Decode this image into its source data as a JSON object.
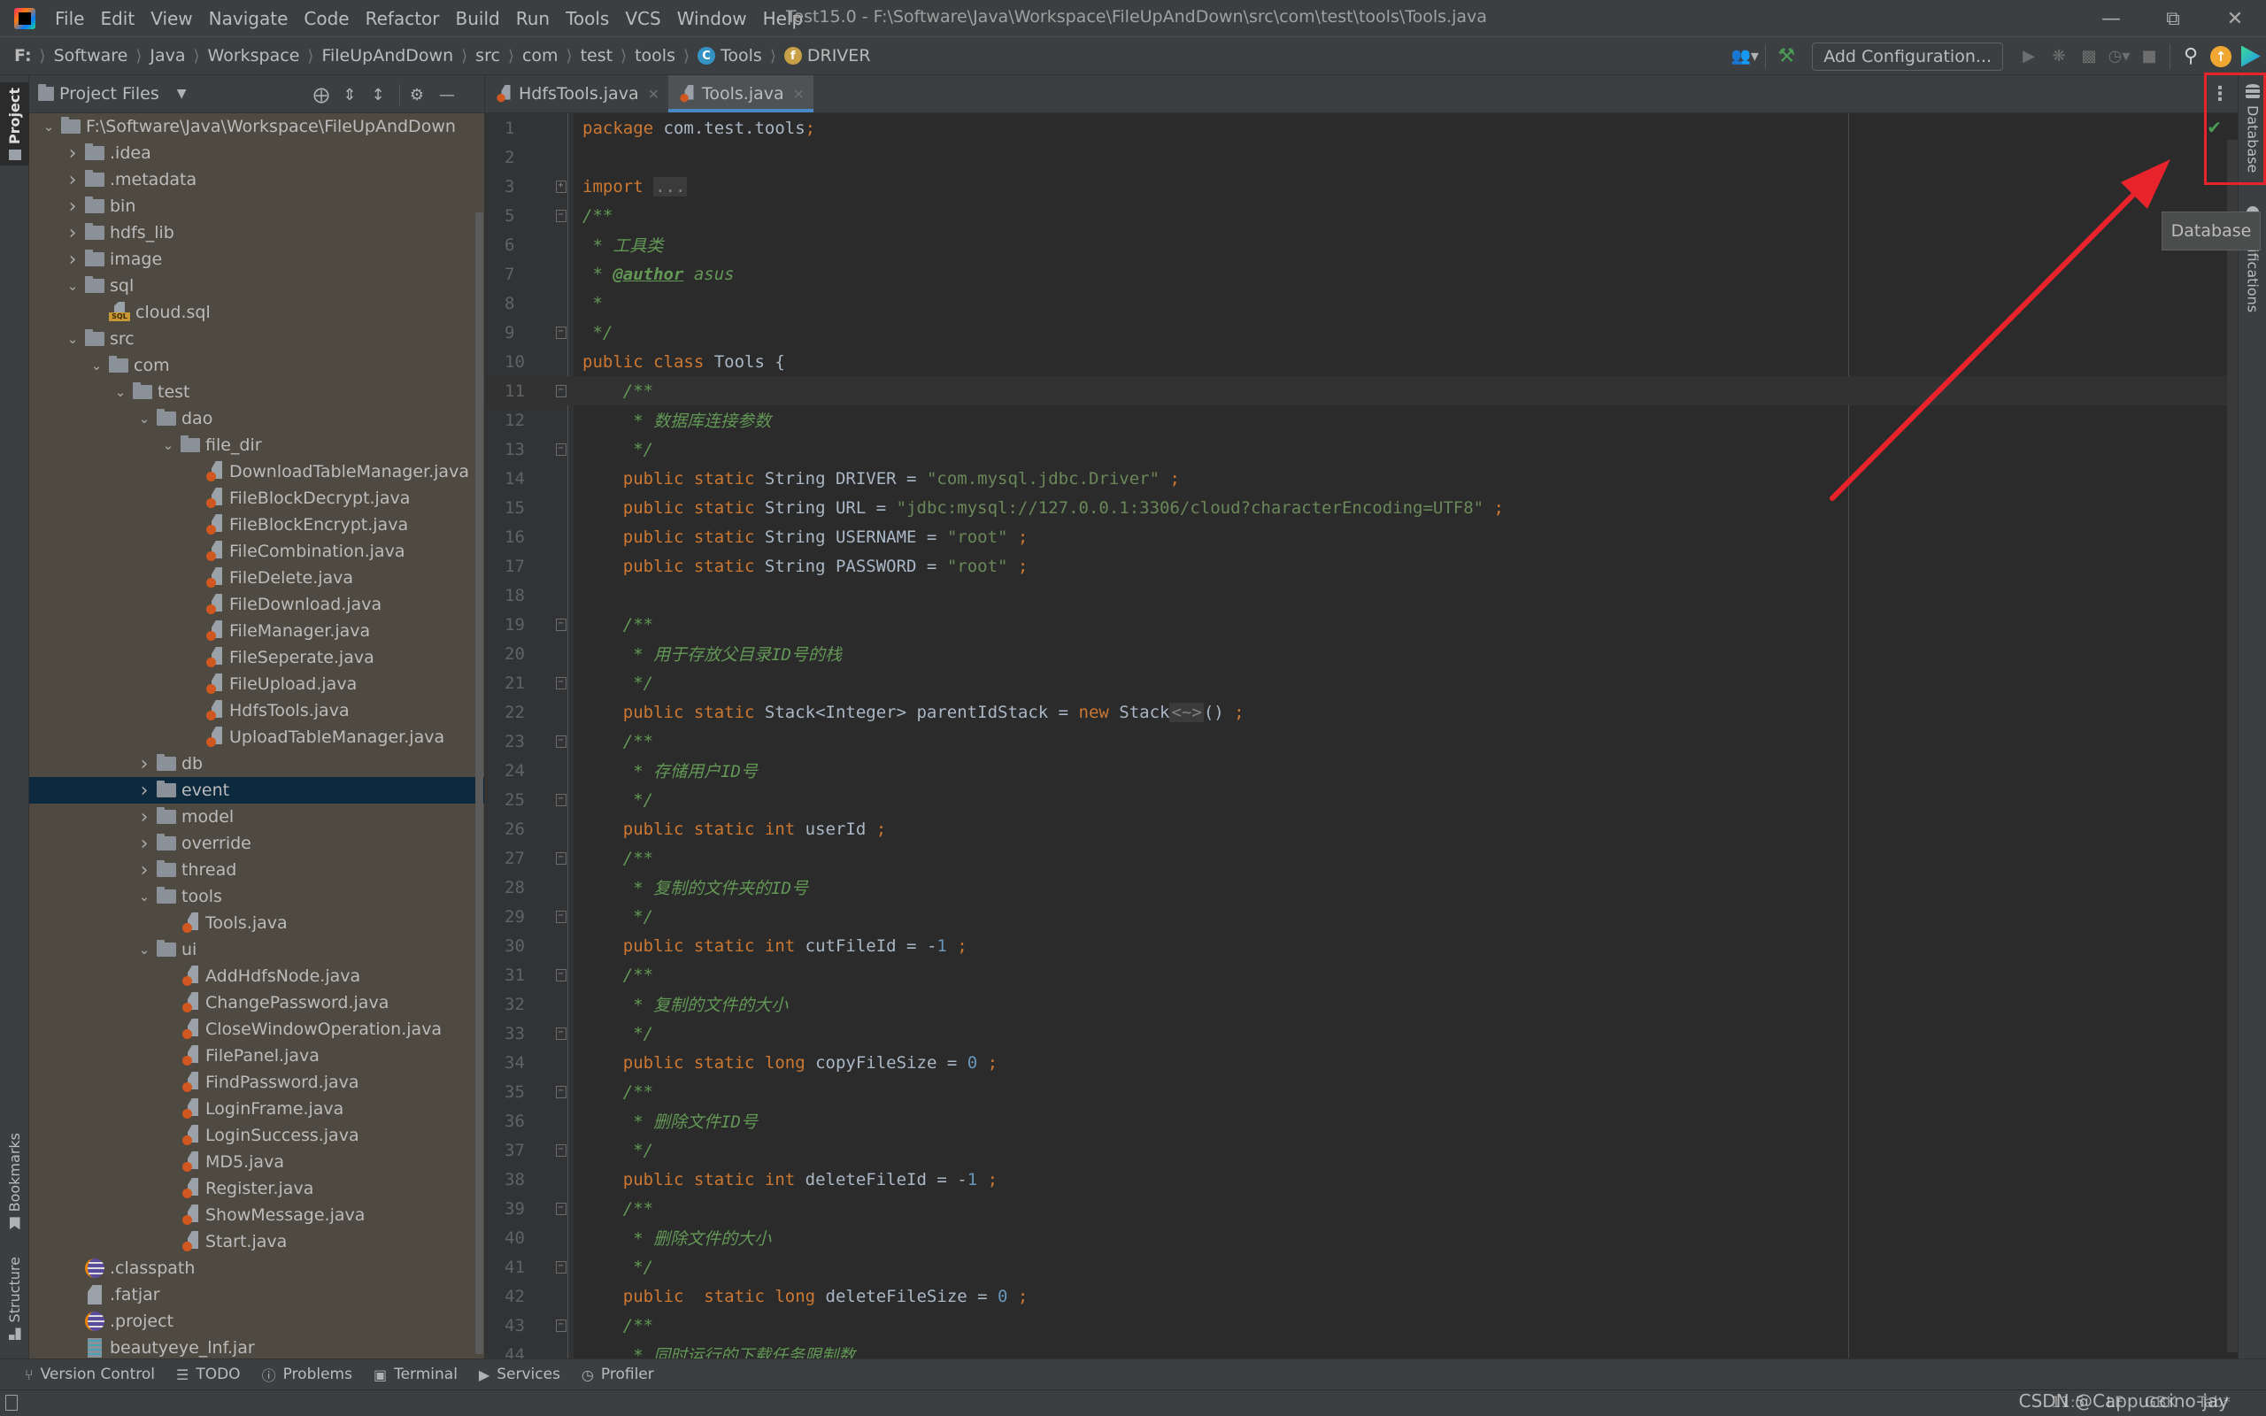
{
  "app": {
    "window_title": "Test15.0 - F:\\Software\\Java\\Workspace\\FileUpAndDown\\src\\com\\test\\tools\\Tools.java",
    "menu": [
      "File",
      "Edit",
      "View",
      "Navigate",
      "Code",
      "Refactor",
      "Build",
      "Run",
      "Tools",
      "VCS",
      "Window",
      "Help"
    ]
  },
  "breadcrumb": [
    "F:",
    "Software",
    "Java",
    "Workspace",
    "FileUpAndDown",
    "src",
    "com",
    "test",
    "tools",
    "Tools",
    "DRIVER"
  ],
  "breadcrumb_icons": {
    "class": "C",
    "field": "f"
  },
  "toolbar": {
    "add_configuration": "Add Configuration..."
  },
  "left_strip": {
    "project": "Project",
    "bookmarks": "Bookmarks",
    "structure": "Structure"
  },
  "right_strip": {
    "database": "Database",
    "notifications": "Notifications"
  },
  "project_panel": {
    "title": "Project Files",
    "tree": [
      {
        "label": "F:\\Software\\Java\\Workspace\\FileUpAndDown",
        "depth": 0,
        "type": "folder",
        "expanded": true
      },
      {
        "label": ".idea",
        "depth": 1,
        "type": "folder",
        "expanded": false
      },
      {
        "label": ".metadata",
        "depth": 1,
        "type": "folder",
        "expanded": false
      },
      {
        "label": "bin",
        "depth": 1,
        "type": "folder",
        "expanded": false
      },
      {
        "label": "hdfs_lib",
        "depth": 1,
        "type": "folder",
        "expanded": false
      },
      {
        "label": "image",
        "depth": 1,
        "type": "folder",
        "expanded": false
      },
      {
        "label": "sql",
        "depth": 1,
        "type": "folder",
        "expanded": true
      },
      {
        "label": "cloud.sql",
        "depth": 2,
        "type": "sql"
      },
      {
        "label": "src",
        "depth": 1,
        "type": "folder",
        "expanded": true
      },
      {
        "label": "com",
        "depth": 2,
        "type": "folder",
        "expanded": true
      },
      {
        "label": "test",
        "depth": 3,
        "type": "folder",
        "expanded": true
      },
      {
        "label": "dao",
        "depth": 4,
        "type": "folder",
        "expanded": true
      },
      {
        "label": "file_dir",
        "depth": 5,
        "type": "folder",
        "expanded": true
      },
      {
        "label": "DownloadTableManager.java",
        "depth": 6,
        "type": "java"
      },
      {
        "label": "FileBlockDecrypt.java",
        "depth": 6,
        "type": "java"
      },
      {
        "label": "FileBlockEncrypt.java",
        "depth": 6,
        "type": "java"
      },
      {
        "label": "FileCombination.java",
        "depth": 6,
        "type": "java"
      },
      {
        "label": "FileDelete.java",
        "depth": 6,
        "type": "java"
      },
      {
        "label": "FileDownload.java",
        "depth": 6,
        "type": "java"
      },
      {
        "label": "FileManager.java",
        "depth": 6,
        "type": "java"
      },
      {
        "label": "FileSeperate.java",
        "depth": 6,
        "type": "java"
      },
      {
        "label": "FileUpload.java",
        "depth": 6,
        "type": "java"
      },
      {
        "label": "HdfsTools.java",
        "depth": 6,
        "type": "java"
      },
      {
        "label": "UploadTableManager.java",
        "depth": 6,
        "type": "java"
      },
      {
        "label": "db",
        "depth": 4,
        "type": "folder",
        "expanded": false
      },
      {
        "label": "event",
        "depth": 4,
        "type": "folder",
        "expanded": false,
        "selected": true
      },
      {
        "label": "model",
        "depth": 4,
        "type": "folder",
        "expanded": false
      },
      {
        "label": "override",
        "depth": 4,
        "type": "folder",
        "expanded": false
      },
      {
        "label": "thread",
        "depth": 4,
        "type": "folder",
        "expanded": false
      },
      {
        "label": "tools",
        "depth": 4,
        "type": "folder",
        "expanded": true
      },
      {
        "label": "Tools.java",
        "depth": 5,
        "type": "java"
      },
      {
        "label": "ui",
        "depth": 4,
        "type": "folder",
        "expanded": true
      },
      {
        "label": "AddHdfsNode.java",
        "depth": 5,
        "type": "java"
      },
      {
        "label": "ChangePassword.java",
        "depth": 5,
        "type": "java"
      },
      {
        "label": "CloseWindowOperation.java",
        "depth": 5,
        "type": "java"
      },
      {
        "label": "FilePanel.java",
        "depth": 5,
        "type": "java"
      },
      {
        "label": "FindPassword.java",
        "depth": 5,
        "type": "java"
      },
      {
        "label": "LoginFrame.java",
        "depth": 5,
        "type": "java"
      },
      {
        "label": "LoginSuccess.java",
        "depth": 5,
        "type": "java"
      },
      {
        "label": "MD5.java",
        "depth": 5,
        "type": "java"
      },
      {
        "label": "Register.java",
        "depth": 5,
        "type": "java"
      },
      {
        "label": "ShowMessage.java",
        "depth": 5,
        "type": "java"
      },
      {
        "label": "Start.java",
        "depth": 5,
        "type": "java"
      },
      {
        "label": ".classpath",
        "depth": 1,
        "type": "eclipse"
      },
      {
        "label": ".fatjar",
        "depth": 1,
        "type": "text"
      },
      {
        "label": ".project",
        "depth": 1,
        "type": "eclipse"
      },
      {
        "label": "beautyeye_lnf.jar",
        "depth": 1,
        "type": "jar"
      }
    ]
  },
  "editor": {
    "tabs": [
      {
        "label": "HdfsTools.java",
        "active": false
      },
      {
        "label": "Tools.java",
        "active": true
      }
    ],
    "current_line": "11",
    "lines": [
      {
        "n": "1",
        "fold": "",
        "tokens": [
          [
            "kw",
            "package "
          ],
          [
            "plain",
            "com.test.tools"
          ],
          [
            "kw",
            ";"
          ]
        ]
      },
      {
        "n": "2",
        "fold": "",
        "tokens": []
      },
      {
        "n": "3",
        "fold": "plus",
        "tokens": [
          [
            "kw",
            "import "
          ],
          [
            "hint",
            "..."
          ]
        ]
      },
      {
        "n": "5",
        "fold": "open",
        "tokens": [
          [
            "cmt",
            "/**"
          ]
        ]
      },
      {
        "n": "6",
        "fold": "",
        "tokens": [
          [
            "cmt",
            " * 工具类"
          ]
        ]
      },
      {
        "n": "7",
        "fold": "",
        "tokens": [
          [
            "cmt",
            " * "
          ],
          [
            "tag",
            "@author"
          ],
          [
            "cmt",
            " asus"
          ]
        ]
      },
      {
        "n": "8",
        "fold": "",
        "tokens": [
          [
            "cmt",
            " *"
          ]
        ]
      },
      {
        "n": "9",
        "fold": "close",
        "tokens": [
          [
            "cmt",
            " */"
          ]
        ]
      },
      {
        "n": "10",
        "fold": "",
        "tokens": [
          [
            "kw",
            "public class "
          ],
          [
            "plain",
            "Tools {"
          ]
        ]
      },
      {
        "n": "11",
        "fold": "open",
        "tokens": [
          [
            "cmt",
            "    /**"
          ]
        ]
      },
      {
        "n": "12",
        "fold": "",
        "tokens": [
          [
            "cmt",
            "     * 数据库连接参数"
          ]
        ]
      },
      {
        "n": "13",
        "fold": "close",
        "tokens": [
          [
            "cmt",
            "     */"
          ]
        ]
      },
      {
        "n": "14",
        "fold": "",
        "tokens": [
          [
            "kw",
            "    public static "
          ],
          [
            "plain",
            "String DRIVER = "
          ],
          [
            "str",
            "\"com.mysql.jdbc.Driver\""
          ],
          [
            "kw",
            " ;"
          ]
        ]
      },
      {
        "n": "15",
        "fold": "",
        "tokens": [
          [
            "kw",
            "    public static "
          ],
          [
            "plain",
            "String URL = "
          ],
          [
            "str",
            "\"jdbc:mysql://127.0.0.1:3306/cloud?characterEncoding=UTF8\""
          ],
          [
            "kw",
            " ;"
          ]
        ]
      },
      {
        "n": "16",
        "fold": "",
        "tokens": [
          [
            "kw",
            "    public static "
          ],
          [
            "plain",
            "String USERNAME = "
          ],
          [
            "str",
            "\"root\""
          ],
          [
            "kw",
            " ;"
          ]
        ]
      },
      {
        "n": "17",
        "fold": "",
        "tokens": [
          [
            "kw",
            "    public static "
          ],
          [
            "plain",
            "String PASSWORD = "
          ],
          [
            "str",
            "\"root\""
          ],
          [
            "kw",
            " ;"
          ]
        ]
      },
      {
        "n": "18",
        "fold": "",
        "tokens": []
      },
      {
        "n": "19",
        "fold": "open",
        "tokens": [
          [
            "cmt",
            "    /**"
          ]
        ]
      },
      {
        "n": "20",
        "fold": "",
        "tokens": [
          [
            "cmt",
            "     * 用于存放父目录ID号的栈"
          ]
        ]
      },
      {
        "n": "21",
        "fold": "close",
        "tokens": [
          [
            "cmt",
            "     */"
          ]
        ]
      },
      {
        "n": "22",
        "fold": "",
        "tokens": [
          [
            "kw",
            "    public static "
          ],
          [
            "plain",
            "Stack<Integer> parentIdStack = "
          ],
          [
            "kw",
            "new "
          ],
          [
            "plain",
            "Stack"
          ],
          [
            "hint",
            "<~>"
          ],
          [
            "plain",
            "()"
          ],
          [
            "kw",
            " ;"
          ]
        ]
      },
      {
        "n": "23",
        "fold": "open",
        "tokens": [
          [
            "cmt",
            "    /**"
          ]
        ]
      },
      {
        "n": "24",
        "fold": "",
        "tokens": [
          [
            "cmt",
            "     * 存储用户ID号"
          ]
        ]
      },
      {
        "n": "25",
        "fold": "close",
        "tokens": [
          [
            "cmt",
            "     */"
          ]
        ]
      },
      {
        "n": "26",
        "fold": "",
        "tokens": [
          [
            "kw",
            "    public static int "
          ],
          [
            "plain",
            "userId"
          ],
          [
            "kw",
            " ;"
          ]
        ]
      },
      {
        "n": "27",
        "fold": "open",
        "tokens": [
          [
            "cmt",
            "    /**"
          ]
        ]
      },
      {
        "n": "28",
        "fold": "",
        "tokens": [
          [
            "cmt",
            "     * 复制的文件夹的ID号"
          ]
        ]
      },
      {
        "n": "29",
        "fold": "close",
        "tokens": [
          [
            "cmt",
            "     */"
          ]
        ]
      },
      {
        "n": "30",
        "fold": "",
        "tokens": [
          [
            "kw",
            "    public static int "
          ],
          [
            "plain",
            "cutFileId = -"
          ],
          [
            "num",
            "1"
          ],
          [
            "kw",
            " ;"
          ]
        ]
      },
      {
        "n": "31",
        "fold": "open",
        "tokens": [
          [
            "cmt",
            "    /**"
          ]
        ]
      },
      {
        "n": "32",
        "fold": "",
        "tokens": [
          [
            "cmt",
            "     * 复制的文件的大小"
          ]
        ]
      },
      {
        "n": "33",
        "fold": "close",
        "tokens": [
          [
            "cmt",
            "     */"
          ]
        ]
      },
      {
        "n": "34",
        "fold": "",
        "tokens": [
          [
            "kw",
            "    public static long "
          ],
          [
            "plain",
            "copyFileSize = "
          ],
          [
            "num",
            "0"
          ],
          [
            "kw",
            " ;"
          ]
        ]
      },
      {
        "n": "35",
        "fold": "open",
        "tokens": [
          [
            "cmt",
            "    /**"
          ]
        ]
      },
      {
        "n": "36",
        "fold": "",
        "tokens": [
          [
            "cmt",
            "     * 删除文件ID号"
          ]
        ]
      },
      {
        "n": "37",
        "fold": "close",
        "tokens": [
          [
            "cmt",
            "     */"
          ]
        ]
      },
      {
        "n": "38",
        "fold": "",
        "tokens": [
          [
            "kw",
            "    public static int "
          ],
          [
            "plain",
            "deleteFileId = -"
          ],
          [
            "num",
            "1"
          ],
          [
            "kw",
            " ;"
          ]
        ]
      },
      {
        "n": "39",
        "fold": "open",
        "tokens": [
          [
            "cmt",
            "    /**"
          ]
        ]
      },
      {
        "n": "40",
        "fold": "",
        "tokens": [
          [
            "cmt",
            "     * 删除文件的大小"
          ]
        ]
      },
      {
        "n": "41",
        "fold": "close",
        "tokens": [
          [
            "cmt",
            "     */"
          ]
        ]
      },
      {
        "n": "42",
        "fold": "",
        "tokens": [
          [
            "kw",
            "    public  static long "
          ],
          [
            "plain",
            "deleteFileSize = "
          ],
          [
            "num",
            "0"
          ],
          [
            "kw",
            " ;"
          ]
        ]
      },
      {
        "n": "43",
        "fold": "open",
        "tokens": [
          [
            "cmt",
            "    /**"
          ]
        ]
      },
      {
        "n": "44",
        "fold": "",
        "tokens": [
          [
            "cmt",
            "     * 同时运行的下载任务限制数"
          ]
        ]
      }
    ]
  },
  "tooltip": "Database",
  "bottom_tools": [
    {
      "label": "Version Control",
      "icon": "version-control-icon"
    },
    {
      "label": "TODO",
      "icon": "todo-icon"
    },
    {
      "label": "Problems",
      "icon": "problems-icon"
    },
    {
      "label": "Terminal",
      "icon": "terminal-icon"
    },
    {
      "label": "Services",
      "icon": "services-icon"
    },
    {
      "label": "Profiler",
      "icon": "profiler-icon"
    }
  ],
  "status_bar": {
    "position": "11:5",
    "line_separator": "LF",
    "encoding": "GBK",
    "indent": "Tab*",
    "watermark": "CSDN @Cappuccino-jay"
  },
  "colors": {
    "accent": "#4a88c7",
    "annotation_red": "#e8232c",
    "keyword": "#cc7832",
    "string": "#6a8759",
    "comment": "#629755",
    "number": "#6897bb"
  }
}
